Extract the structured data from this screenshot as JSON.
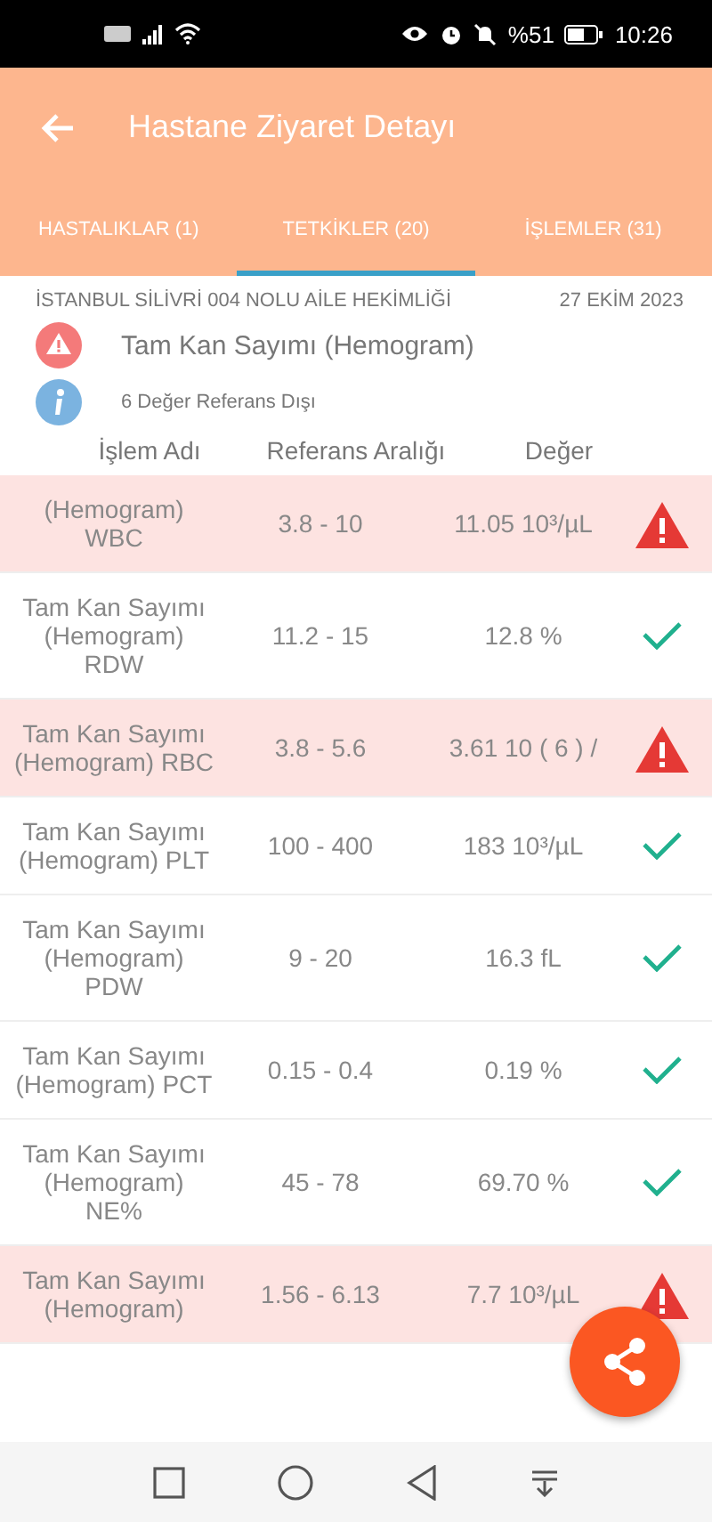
{
  "status_bar": {
    "battery": "%51",
    "time": "10:26"
  },
  "app_bar": {
    "title": "Hastane Ziyaret Detayı"
  },
  "tabs": [
    {
      "label": "HASTALIKLAR (1)",
      "selected": false
    },
    {
      "label": "TETKİKLER (20)",
      "selected": true
    },
    {
      "label": "İŞLEMLER (31)",
      "selected": false
    }
  ],
  "info": {
    "facility": "İSTANBUL SİLİVRİ 004 NOLU AİLE HEKİMLİĞİ",
    "date": "27 EKİM 2023",
    "test_name": "Tam Kan Sayımı (Hemogram)",
    "summary": "6 Değer Referans Dışı"
  },
  "table": {
    "columns": [
      "İşlem Adı",
      "Referans Aralığı",
      "Değer"
    ],
    "rows": [
      {
        "name": "(Hemogram) WBC",
        "range": "3.8 - 10",
        "value": "11.05 10³/µL",
        "out_of_range": true
      },
      {
        "name": "Tam Kan Sayımı (Hemogram) RDW",
        "range": "11.2 - 15",
        "value": "12.8 %",
        "out_of_range": false
      },
      {
        "name": "Tam Kan Sayımı (Hemogram) RBC",
        "range": "3.8 - 5.6",
        "value": "3.61 10 ( 6 ) /",
        "out_of_range": true
      },
      {
        "name": "Tam Kan Sayımı (Hemogram) PLT",
        "range": "100 - 400",
        "value": "183 10³/µL",
        "out_of_range": false
      },
      {
        "name": "Tam Kan Sayımı (Hemogram) PDW",
        "range": "9 - 20",
        "value": "16.3 fL",
        "out_of_range": false
      },
      {
        "name": "Tam Kan Sayımı (Hemogram) PCT",
        "range": "0.15 - 0.4",
        "value": "0.19 %",
        "out_of_range": false
      },
      {
        "name": "Tam Kan Sayımı (Hemogram) NE%",
        "range": "45 - 78",
        "value": "69.70 %",
        "out_of_range": false
      },
      {
        "name": "Tam Kan Sayımı (Hemogram)",
        "range": "1.56 - 6.13",
        "value": "7.7 10³/µL",
        "out_of_range": true
      }
    ]
  }
}
